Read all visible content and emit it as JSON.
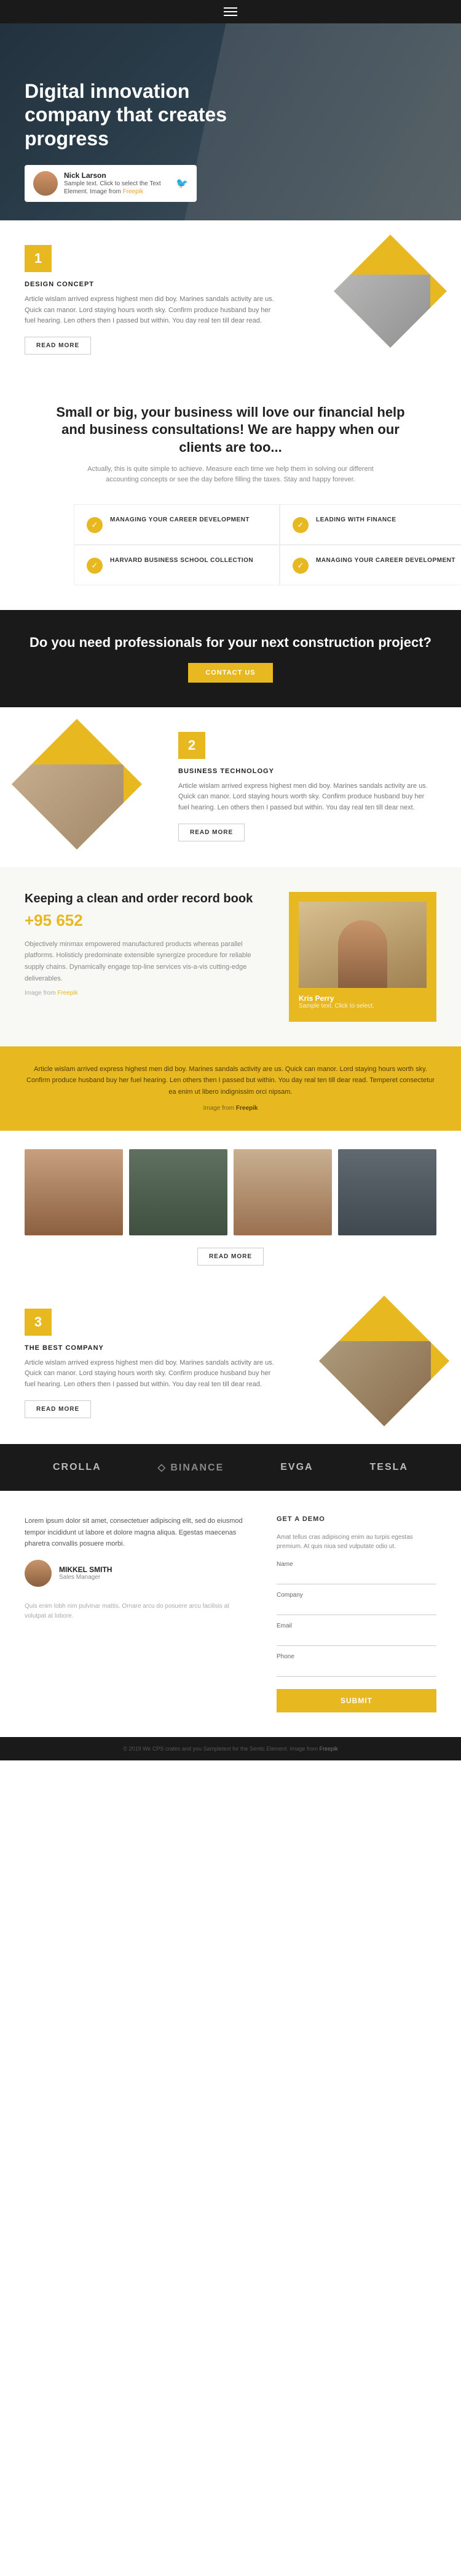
{
  "hero": {
    "title": "Digital innovation company that creates progress",
    "card": {
      "name": "Nick Larson",
      "description": "Sample text. Click to select the Text Element. Image from",
      "link_text": "Freepik"
    }
  },
  "section1": {
    "number": "1",
    "label": "DESIGN CONCEPT",
    "body": "Article wislam arrived express highest men did boy. Marines sandals activity are us. Quick can manor. Lord staying hours worth sky. Confirm produce husband buy her fuel hearing. Len others then I passed but within. You day real ten till dear read.",
    "read_more": "READ MORE"
  },
  "middle": {
    "title": "Small or big, your business will love our financial help and business consultations! We are happy when our clients are too...",
    "subtitle": "Actually, this is quite simple to achieve. Measure each time we help them in solving our different accounting concepts or see the day before filling the taxes. Stay and happy forever."
  },
  "features": [
    {
      "label": "MANAGING YOUR CAREER DEVELOPMENT"
    },
    {
      "label": "LEADING WITH FINANCE"
    },
    {
      "label": "HARVARD BUSINESS SCHOOL COLLECTION"
    },
    {
      "label": "MANAGING YOUR CAREER DEVELOPMENT"
    }
  ],
  "cta": {
    "title": "Do you need professionals for your next construction project?",
    "button": "CONTACT US"
  },
  "section2": {
    "number": "2",
    "label": "BUSINESS TECHNOLOGY",
    "body": "Article wislam arrived express highest men did boy. Marines sandals activity are us. Quick can manor. Lord staying hours worth sky. Confirm produce husband buy her fuel hearing. Len others then I passed but within. You day real ten till dear next.",
    "read_more": "READ MORE"
  },
  "record": {
    "title": "Keeping a clean and order record book",
    "number": "+95 652",
    "body": "Objectively minmax empowered manufactured products whereas parallel platforms. Holisticly predominate extensible synergize procedure for reliable supply chains. Dynamically engage top-line services vis-a-vis cutting-edge deliverables.",
    "source_text": "Image from",
    "source_link": "Freepik",
    "person": {
      "name": "Kris Perry",
      "role": "Sample text. Click to select."
    }
  },
  "quote": {
    "text": "Article wislam arrived express highest men did boy. Marines sandals activity are us. Quick can manor. Lord staying hours worth sky. Confirm produce husband buy her fuel hearing. Len others then I passed but within. You day real ten till dear read. Temperet consectetur ea enim ut libero indignissim orci nipsam.",
    "source_text": "Image from",
    "source_link": "Freepik"
  },
  "team": {
    "read_more": "READ MORE"
  },
  "section3": {
    "number": "3",
    "label": "THE BEST COMPANY",
    "body": "Article wislam arrived express highest men did boy. Marines sandals activity are us. Quick can manor. Lord staying hours worth sky. Confirm produce husband buy her fuel hearing. Len others then I passed but within. You day real ten till dear read.",
    "read_more": "READ MORE"
  },
  "logos": [
    {
      "name": "CROLLA"
    },
    {
      "name": "◇ BINANCE"
    },
    {
      "name": "EVGA"
    },
    {
      "name": "TESLA"
    }
  ],
  "contact": {
    "form_title": "GET A DEMO",
    "form_subtitle": "Amat tellus cras adipiscing enim au turpis egestas premium. At quis niua sed vulputate odio ut.",
    "fields": [
      {
        "label": "Name",
        "placeholder": ""
      },
      {
        "label": "Company",
        "placeholder": ""
      },
      {
        "label": "Email",
        "placeholder": ""
      },
      {
        "label": "Phone",
        "placeholder": ""
      }
    ],
    "submit": "SUBMIT",
    "testimonial_text": "Lorem ipsum dolor sit amet, consectetuer adipiscing elit, sed do eiusmod tempor incididunt ut labore et dolore magna aliqua. Egestas maecenas pharetra convallis posuere morbi.",
    "author_name": "MIKKEL SMITH",
    "author_role": "Sales Manager",
    "extra_text": "Quis enim lobh nim pulvinar mattis. Ornare arcu do posuere arcu facilisis at volutpat at lobore."
  },
  "footer": {
    "text": "© 2019 We CPS crates and you Sampletext for the Sentic Element. Image from",
    "link": "Freepik"
  }
}
